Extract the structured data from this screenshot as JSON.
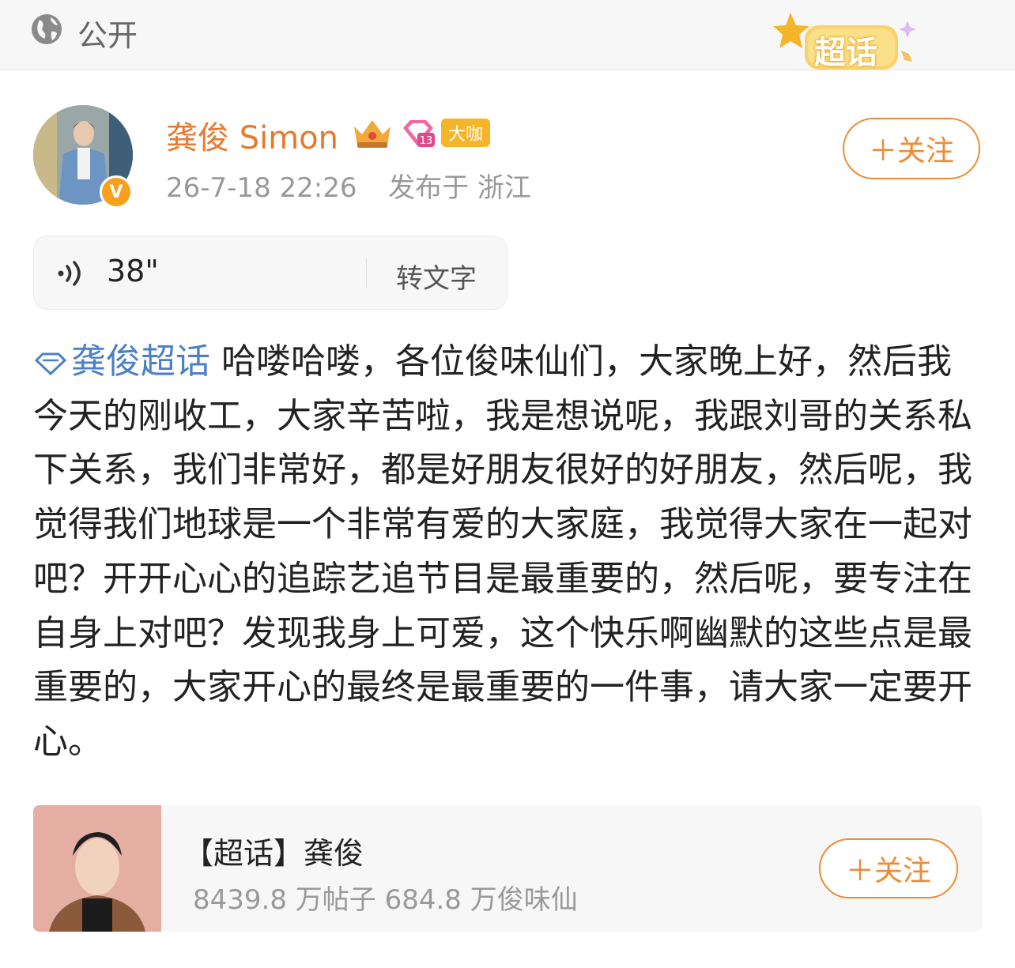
{
  "topbar": {
    "visibility_label": "公开",
    "visibility_icon": "globe-icon",
    "badge_label": "超话"
  },
  "post": {
    "username": "龚俊 Simon",
    "badge_label": "大咖",
    "timestamp": "26-7-18 22:26",
    "location": "发布于 浙江",
    "follow_label": "＋关注"
  },
  "voice": {
    "duration": "38\"",
    "to_text_label": "转文字"
  },
  "content": {
    "topic": "龚俊超话",
    "text": " 哈喽哈喽，各位俊味仙们，大家晚上好，然后我今天的刚收工，大家辛苦啦，我是想说呢，我跟刘哥的关系私下关系，我们非常好，都是好朋友很好的好朋友，然后呢，我觉得我们地球是一个非常有爱的大家庭，我觉得大家在一起对吧？开开心心的追踪艺追节目是最重要的，然后呢，要专注在自身上对吧？发现我身上可爱，这个快乐啊幽默的这些点是最重要的，大家开心的最终是最重要的一件事，请大家一定要开心。"
  },
  "card": {
    "title": "【超话】龚俊",
    "stats": "8439.8 万帖子 684.8 万俊味仙",
    "follow_label": "＋关注"
  },
  "colors": {
    "accent_orange": "#f08a34",
    "username_orange": "#e7792c",
    "link_blue": "#4c80c5",
    "muted_gray": "#999999"
  }
}
